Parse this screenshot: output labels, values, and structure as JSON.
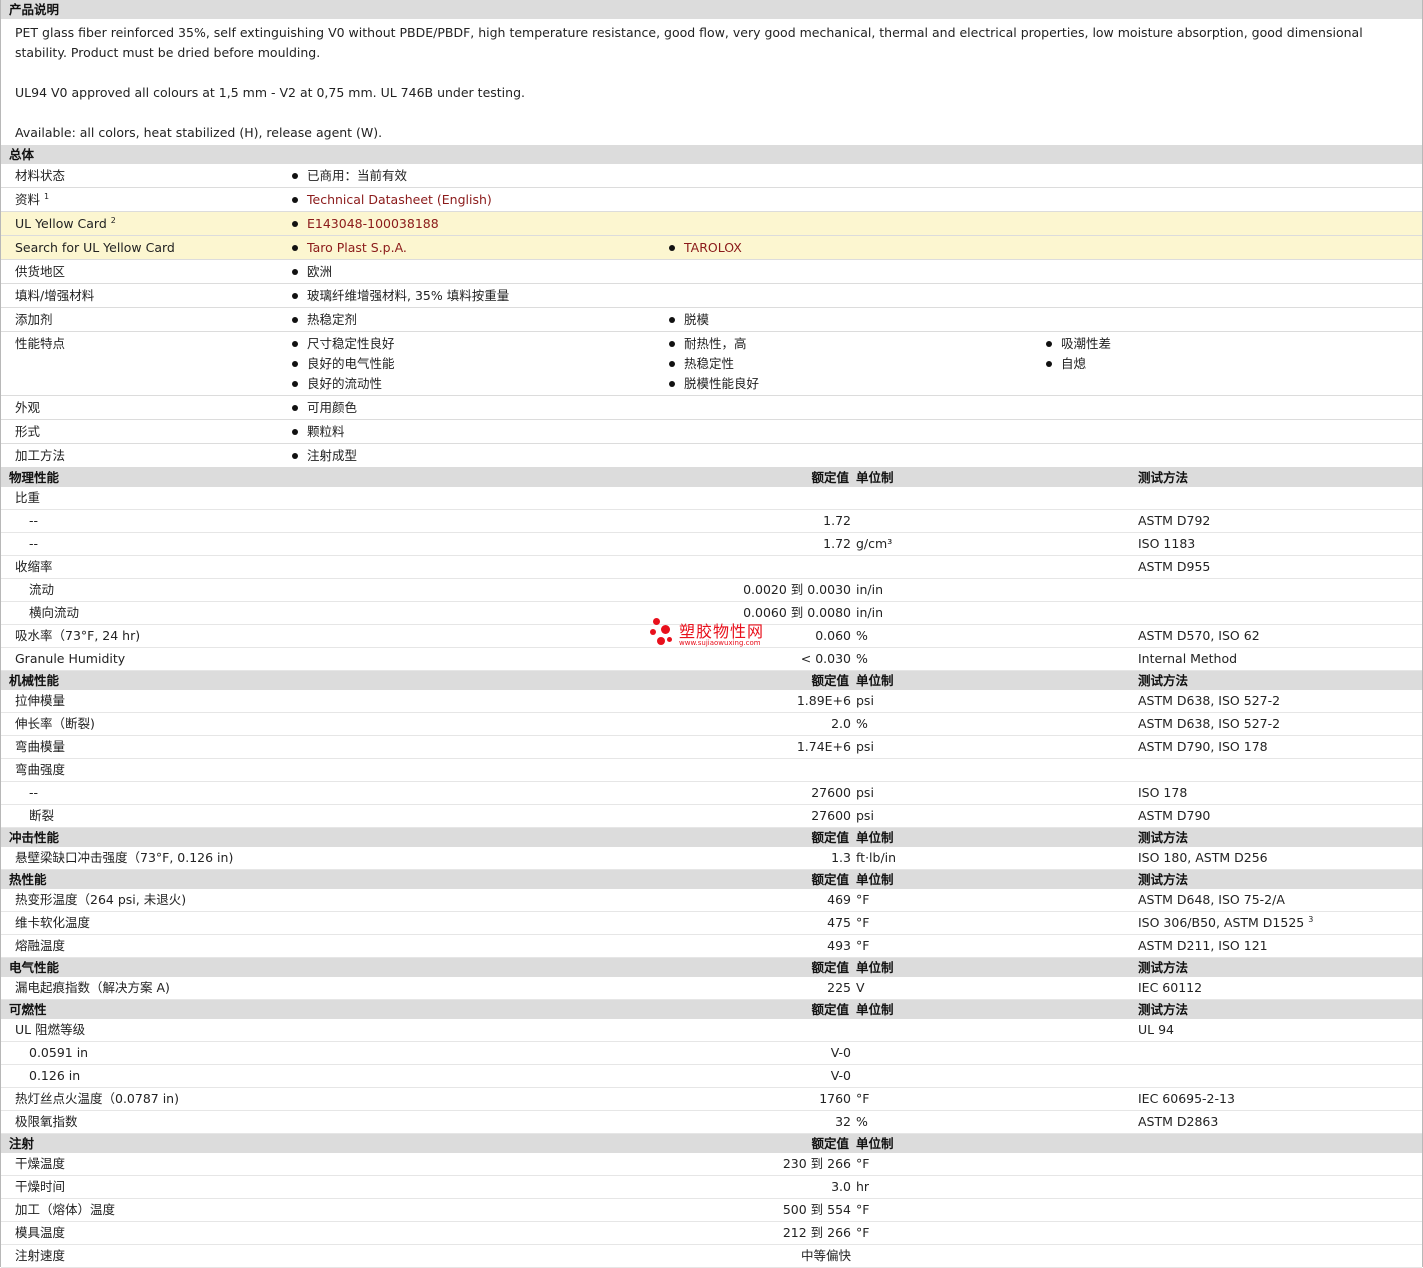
{
  "description": {
    "title": "产品说明",
    "paragraphs": [
      "PET glass fiber reinforced 35%, self extinguishing V0 without PBDE/PBDF, high temperature resistance, good flow, very good mechanical, thermal and electrical properties, low moisture absorption, good dimensional stability. Product must be dried before moulding.",
      "UL94 V0 approved all colours at 1,5 mm - V2 at 0,75 mm. UL 746B under testing.",
      "Available: all colors, heat stabilized (H), release agent (W)."
    ]
  },
  "general": {
    "title": "总体",
    "rows": [
      {
        "label": "材料状态",
        "items": [
          "已商用：当前有效"
        ]
      },
      {
        "label": "资料",
        "sup": "1",
        "items": [
          "Technical Datasheet (English)"
        ],
        "link": true
      },
      {
        "label": "UL Yellow Card",
        "sup": "2",
        "items": [
          "E143048-100038188"
        ],
        "link": true,
        "yellow": true
      },
      {
        "label": "Search for UL Yellow Card",
        "items": [
          "Taro Plast S.p.A.",
          "TAROLOX"
        ],
        "link": true,
        "yellow": true
      },
      {
        "label": "供货地区",
        "items": [
          "欧洲"
        ]
      },
      {
        "label": "填料/增强材料",
        "items": [
          "玻璃纤维增强材料, 35% 填料按重量"
        ]
      },
      {
        "label": "添加剂",
        "items": [
          "热稳定剂",
          "脱模"
        ]
      },
      {
        "label": "性能特点",
        "items": [
          "尺寸稳定性良好",
          "耐热性，高",
          "吸潮性差",
          "良好的电气性能",
          "热稳定性",
          "自熄",
          "良好的流动性",
          "脱模性能良好"
        ]
      },
      {
        "label": "外观",
        "items": [
          "可用颜色"
        ]
      },
      {
        "label": "形式",
        "items": [
          "颗粒料"
        ]
      },
      {
        "label": "加工方法",
        "items": [
          "注射成型"
        ]
      }
    ]
  },
  "headers": {
    "value": "额定值",
    "unit": "单位制",
    "method": "测试方法"
  },
  "sections": [
    {
      "title": "物理性能",
      "rows": [
        {
          "label": "比重",
          "value": "",
          "unit": "",
          "method": ""
        },
        {
          "label": "--",
          "sub": true,
          "value": "1.72",
          "unit": "",
          "method": "ASTM D792"
        },
        {
          "label": "--",
          "sub": true,
          "value": "1.72",
          "unit": "g/cm³",
          "method": "ISO 1183"
        },
        {
          "label": "收缩率",
          "value": "",
          "unit": "",
          "method": "ASTM D955"
        },
        {
          "label": "流动",
          "sub": true,
          "value": "0.0020 到  0.0030",
          "unit": "in/in",
          "method": ""
        },
        {
          "label": "横向流动",
          "sub": true,
          "value": "0.0060 到  0.0080",
          "unit": "in/in",
          "method": ""
        },
        {
          "label": "吸水率（73°F, 24 hr)",
          "value": "0.060",
          "unit": "%",
          "method": "ASTM D570, ISO 62"
        },
        {
          "label": "Granule Humidity",
          "value": "< 0.030",
          "unit": "%",
          "method": "Internal Method"
        }
      ]
    },
    {
      "title": "机械性能",
      "rows": [
        {
          "label": "拉伸模量",
          "value": "1.89E+6",
          "unit": "psi",
          "method": "ASTM D638, ISO 527-2"
        },
        {
          "label": "伸长率（断裂)",
          "value": "2.0",
          "unit": "%",
          "method": "ASTM D638, ISO 527-2"
        },
        {
          "label": "弯曲模量",
          "value": "1.74E+6",
          "unit": "psi",
          "method": "ASTM D790, ISO 178"
        },
        {
          "label": "弯曲强度",
          "value": "",
          "unit": "",
          "method": ""
        },
        {
          "label": "--",
          "sub": true,
          "value": "27600",
          "unit": "psi",
          "method": "ISO 178"
        },
        {
          "label": "断裂",
          "sub": true,
          "value": "27600",
          "unit": "psi",
          "method": "ASTM D790"
        }
      ]
    },
    {
      "title": "冲击性能",
      "rows": [
        {
          "label": "悬壁梁缺口冲击强度（73°F, 0.126 in)",
          "value": "1.3",
          "unit": "ft·lb/in",
          "method": "ISO 180, ASTM D256"
        }
      ]
    },
    {
      "title": "热性能",
      "rows": [
        {
          "label": "热变形温度（264 psi, 未退火)",
          "value": "469",
          "unit": "°F",
          "method": "ASTM D648, ISO 75-2/A"
        },
        {
          "label": "维卡软化温度",
          "value": "475",
          "unit": "°F",
          "method": "ISO 306/B50, ASTM D1525",
          "sup": "3"
        },
        {
          "label": "熔融温度",
          "value": "493",
          "unit": "°F",
          "method": "ASTM D211, ISO 121"
        }
      ]
    },
    {
      "title": "电气性能",
      "rows": [
        {
          "label": "漏电起痕指数（解决方案  A)",
          "value": "225",
          "unit": "V",
          "method": "IEC 60112"
        }
      ]
    },
    {
      "title": "可燃性",
      "rows": [
        {
          "label": "UL 阻燃等级",
          "value": "",
          "unit": "",
          "method": "UL 94"
        },
        {
          "label": "0.0591 in",
          "sub": true,
          "value": "V-0",
          "unit": "",
          "method": ""
        },
        {
          "label": "0.126 in",
          "sub": true,
          "value": "V-0",
          "unit": "",
          "method": ""
        },
        {
          "label": "热灯丝点火温度（0.0787 in)",
          "value": "1760",
          "unit": "°F",
          "method": "IEC 60695-2-13"
        },
        {
          "label": "极限氧指数",
          "value": "32",
          "unit": "%",
          "method": "ASTM D2863"
        }
      ]
    },
    {
      "title": "注射",
      "nomethod": true,
      "rows": [
        {
          "label": "干燥温度",
          "value": "230 到  266",
          "unit": "°F",
          "method": ""
        },
        {
          "label": "干燥时间",
          "value": "3.0",
          "unit": "hr",
          "method": ""
        },
        {
          "label": "加工（熔体）温度",
          "value": "500 到  554",
          "unit": "°F",
          "method": ""
        },
        {
          "label": "模具温度",
          "value": "212 到  266",
          "unit": "°F",
          "method": ""
        },
        {
          "label": "注射速度",
          "value": "中等偏快",
          "unit": "",
          "method": ""
        }
      ]
    }
  ],
  "watermark": {
    "name": "塑胶物性网",
    "url": "www.sujiaowuxing.com"
  }
}
